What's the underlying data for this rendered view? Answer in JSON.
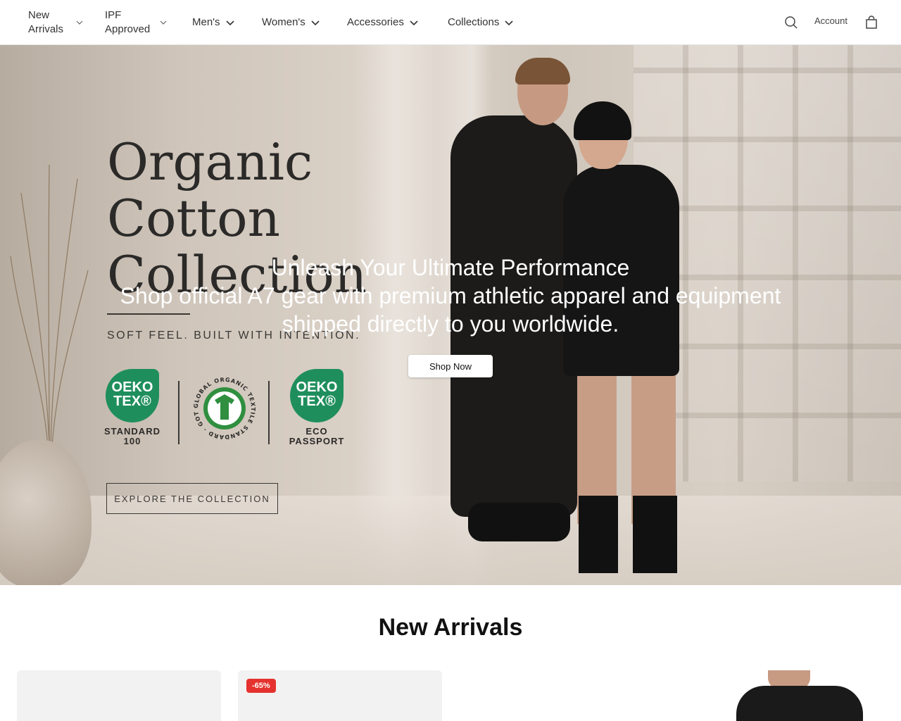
{
  "header": {
    "nav": [
      {
        "label": "New Arrivals",
        "has_dropdown": true
      },
      {
        "label": "IPF Approved",
        "has_dropdown": true
      },
      {
        "label": "Men's",
        "has_dropdown": true
      },
      {
        "label": "Women's",
        "has_dropdown": true
      },
      {
        "label": "Accessories",
        "has_dropdown": true
      },
      {
        "label": "Collections",
        "has_dropdown": true
      }
    ],
    "account_label": "Account",
    "icons": {
      "search": "search-icon",
      "cart": "shopping-bag-icon"
    }
  },
  "hero": {
    "image": {
      "title_line1": "Organic",
      "title_line2": "Cotton",
      "title_line3": "Collection",
      "tagline": "SOFT FEEL. BUILT WITH INTENTION.",
      "badge1_logo": "OEKO TEX®",
      "badge1_caption": "STANDARD 100",
      "badge2_logo": "GLOBAL ORGANIC TEXTILE STANDARD · GOTS ·",
      "badge3_logo": "OEKO TEX®",
      "badge3_caption": "ECO PASSPORT",
      "explore_label": "EXPLORE THE COLLECTION"
    },
    "overlay_title": "Unleash Your Ultimate Performance",
    "overlay_subtitle": "Shop official A7 gear with premium athletic apparel and equipment shipped directly to you worldwide.",
    "cta_label": "Shop Now"
  },
  "new_arrivals": {
    "title": "New Arrivals",
    "cards": [
      {
        "badge": ""
      },
      {
        "badge": "-65%"
      },
      {
        "badge": ""
      },
      {
        "badge": ""
      }
    ]
  },
  "colors": {
    "brand_green": "#1f8e5d",
    "sale_red": "#e5322e",
    "text_dark": "#111111"
  }
}
